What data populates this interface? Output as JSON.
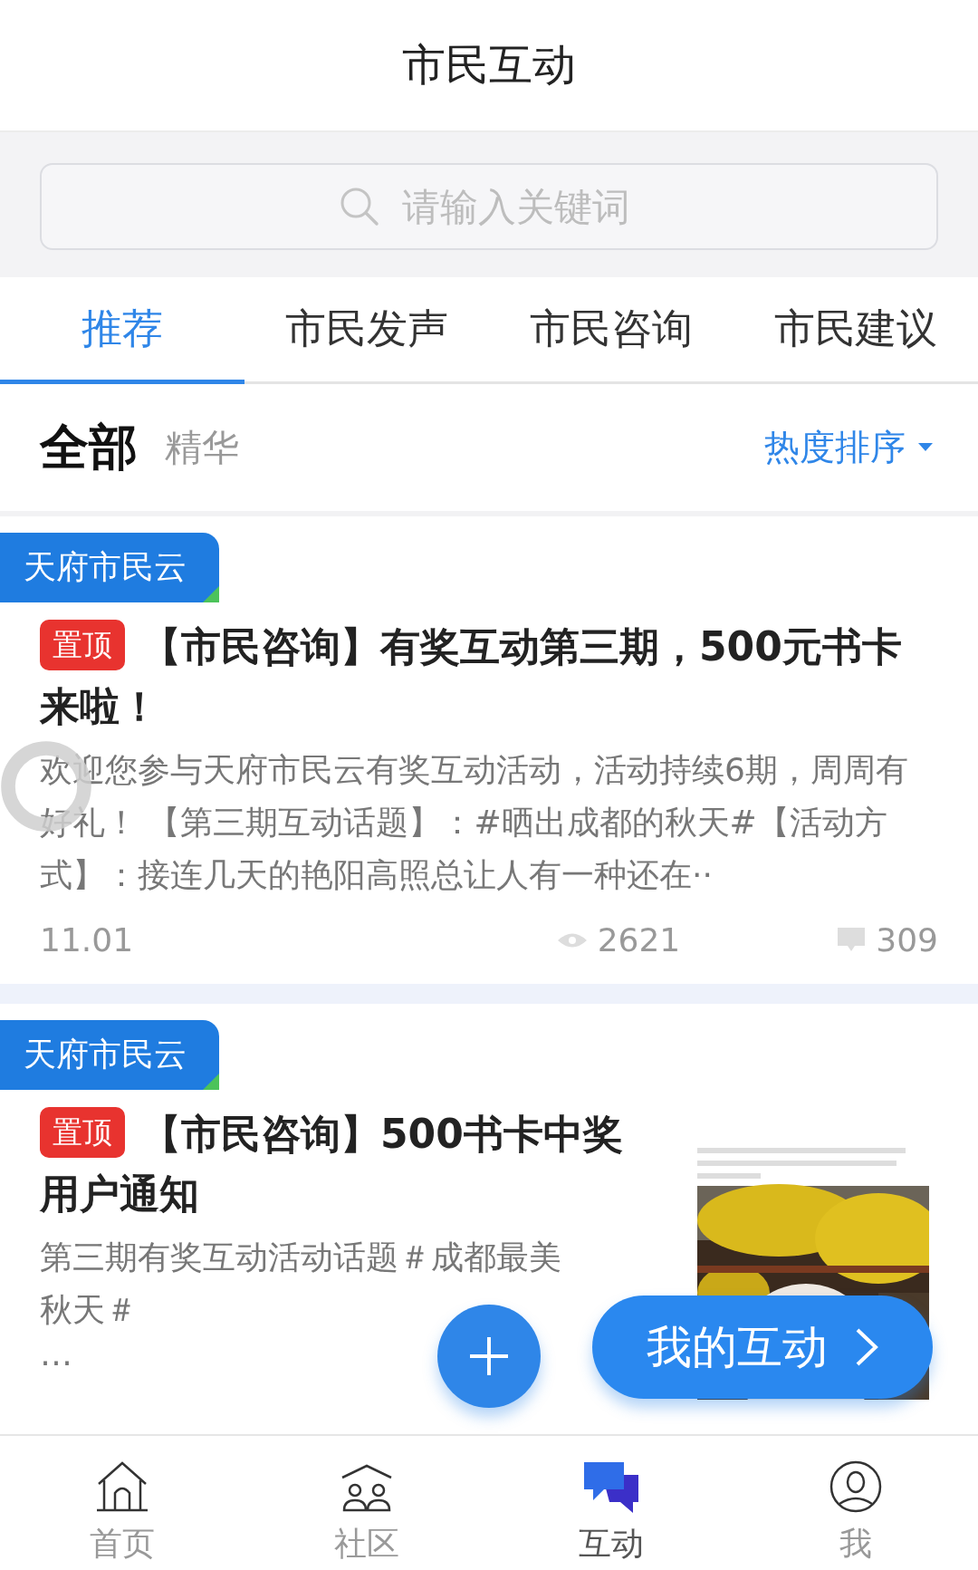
{
  "header": {
    "title": "市民互动"
  },
  "search": {
    "placeholder": "请输入关键词"
  },
  "tabs": [
    {
      "label": "推荐",
      "selected": true
    },
    {
      "label": "市民发声",
      "selected": false
    },
    {
      "label": "市民咨询",
      "selected": false
    },
    {
      "label": "市民建议",
      "selected": false
    }
  ],
  "filters": [
    {
      "label": "全部",
      "selected": true
    },
    {
      "label": "精华",
      "selected": false
    }
  ],
  "sort": {
    "label": "热度排序"
  },
  "posts": [
    {
      "source": "天府市民云",
      "badge": "置顶",
      "title": "【市民咨询】有奖互动第三期，500元书卡来啦！",
      "summary": "欢迎您参与天府市民云有奖互动活动，活动持续6期，周周有好礼！ 【第三期互动话题】：#晒出成都的秋天#【活动方式】：接连几天的艳阳高照总让人有一种还在··",
      "date": "11.01",
      "views": "2621",
      "comments": "309"
    },
    {
      "source": "天府市民云",
      "badge": "置顶",
      "title": "【市民咨询】500书卡中奖用户通知",
      "summary": "第三期有奖互动活动话题＃成都最美秋天＃",
      "more": "…"
    }
  ],
  "my_button": {
    "label": "我的互动"
  },
  "nav": [
    {
      "label": "首页",
      "kind": "home",
      "selected": false
    },
    {
      "label": "社区",
      "kind": "community",
      "selected": false
    },
    {
      "label": "互动",
      "kind": "chat",
      "selected": true
    },
    {
      "label": "我",
      "kind": "user",
      "selected": false
    }
  ]
}
